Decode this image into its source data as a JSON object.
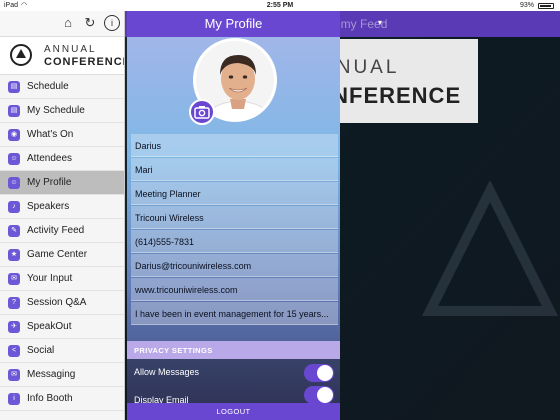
{
  "status_bar": {
    "carrier": "iPad",
    "time": "2:55 PM",
    "battery": "93%",
    "battery_level": 0.93
  },
  "background": {
    "title": "Save my Feed",
    "banner_line1": "NNUAL",
    "banner_line2": "ONFERENCE"
  },
  "sidebar": {
    "logo_line1": "ANNUAL",
    "logo_line2": "CONFERENCE",
    "items": [
      {
        "label": "Schedule",
        "icon": "calendar-icon",
        "glyph": "▤"
      },
      {
        "label": "My Schedule",
        "icon": "my-schedule-icon",
        "glyph": "▤"
      },
      {
        "label": "What's On",
        "icon": "whats-on-icon",
        "glyph": "◉"
      },
      {
        "label": "Attendees",
        "icon": "attendees-icon",
        "glyph": "☺"
      },
      {
        "label": "My Profile",
        "icon": "profile-icon",
        "glyph": "☺"
      },
      {
        "label": "Speakers",
        "icon": "speakers-icon",
        "glyph": "♪"
      },
      {
        "label": "Activity Feed",
        "icon": "activity-feed-icon",
        "glyph": "✎"
      },
      {
        "label": "Game Center",
        "icon": "game-center-icon",
        "glyph": "★"
      },
      {
        "label": "Your Input",
        "icon": "your-input-icon",
        "glyph": "✉"
      },
      {
        "label": "Session Q&A",
        "icon": "qa-icon",
        "glyph": "?"
      },
      {
        "label": "SpeakOut",
        "icon": "speakout-icon",
        "glyph": "✈"
      },
      {
        "label": "Social",
        "icon": "social-icon",
        "glyph": "<"
      },
      {
        "label": "Messaging",
        "icon": "messaging-icon",
        "glyph": "✉"
      },
      {
        "label": "Info Booth",
        "icon": "info-booth-icon",
        "glyph": "i"
      }
    ],
    "active_index": 4
  },
  "panel": {
    "title": "My Profile",
    "fields": [
      "Darius",
      "Mari",
      "Meeting Planner",
      "Tricouni Wireless",
      "(614)555-7831",
      "Darius@tricouniwireless.com",
      "www.tricouniwireless.com",
      "I have been in event management for 15 years..."
    ],
    "privacy_header": "PRIVACY SETTINGS",
    "allow_messages": "Allow Messages",
    "display_email": "Display Email",
    "logout": "LOGOUT"
  },
  "colors": {
    "accent": "#6a47d1",
    "menu_icon": "#6b58d6",
    "active_row": "#bdbdbd"
  }
}
